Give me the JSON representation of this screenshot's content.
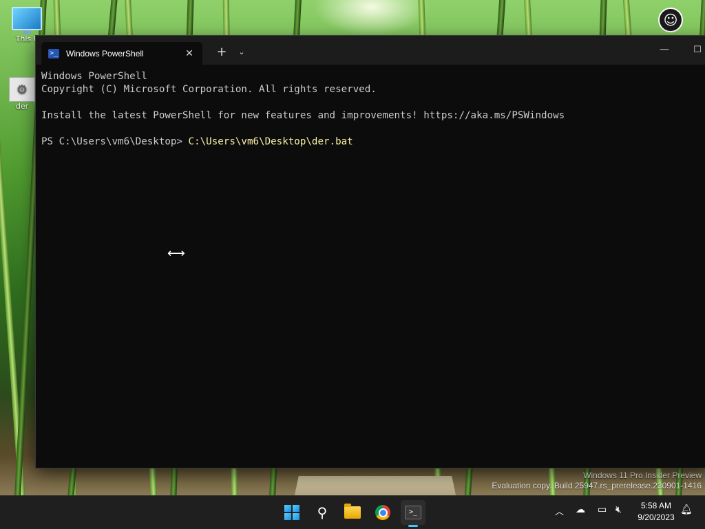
{
  "desktop": {
    "icons": [
      {
        "label": "This P"
      },
      {
        "label": "der"
      }
    ],
    "watermark_line1": "Windows 11 Pro Insider Preview",
    "watermark_line2": "Evaluation copy. Build 25947.rs_prerelease.230901-1416"
  },
  "window": {
    "tab_title": "Windows PowerShell",
    "tab_close": "✕",
    "new_tab": "+",
    "dropdown": "⌄",
    "minimize": "—",
    "maximize": "☐"
  },
  "console": {
    "lines": [
      "Windows PowerShell",
      "Copyright (C) Microsoft Corporation. All rights reserved.",
      "",
      "Install the latest PowerShell for new features and improvements! https://aka.ms/PSWindows",
      ""
    ],
    "prompt": "PS C:\\Users\\vm6\\Desktop> ",
    "command": "C:\\Users\\vm6\\Desktop\\der.bat"
  },
  "taskbar": {
    "clock_time": "5:58 AM",
    "clock_date": "9/20/2023",
    "icons": [
      "start-icon",
      "search-icon",
      "file-explorer-icon",
      "chrome-icon",
      "terminal-icon"
    ],
    "tray_icons": [
      "chevron-up-icon",
      "onedrive-icon",
      "network-icon",
      "volume-muted-icon",
      "notification-bell-icon"
    ]
  },
  "colors": {
    "console_bg": "#0c0c0c",
    "console_text": "#cccccc",
    "command_text": "#f9f1a5",
    "taskbar_bg": "#1f1f1f",
    "accent": "#4cc2ff"
  }
}
